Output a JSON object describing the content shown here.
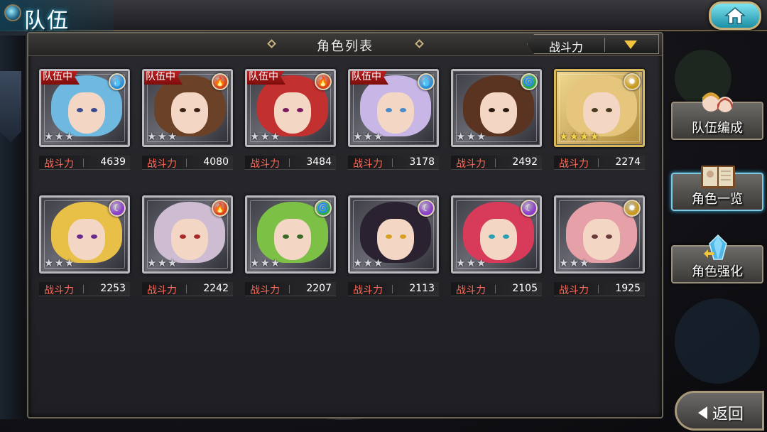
{
  "header": {
    "screen_title": "队伍",
    "home_icon": "home-icon"
  },
  "panel": {
    "title": "角色列表",
    "sort": {
      "label": "战斗力",
      "arrow_icon": "dropdown-triangle-icon"
    }
  },
  "characters": [
    {
      "badge": "队伍中",
      "element": "water",
      "element_color": "#2f8fd6",
      "stars": 3,
      "gold": false,
      "power_label": "战斗力",
      "power": "4639",
      "hair": "#6fb8e0",
      "eyes": "#3b4b8c"
    },
    {
      "badge": "队伍中",
      "element": "fire",
      "element_color": "#d8441c",
      "stars": 3,
      "gold": false,
      "power_label": "战斗力",
      "power": "4080",
      "hair": "#6b4228",
      "eyes": "#3a2214"
    },
    {
      "badge": "队伍中",
      "element": "fire",
      "element_color": "#d8441c",
      "stars": 3,
      "gold": false,
      "power_label": "战斗力",
      "power": "3484",
      "hair": "#c23030",
      "eyes": "#7a1c5c"
    },
    {
      "badge": "队伍中",
      "element": "water",
      "element_color": "#2f8fd6",
      "stars": 3,
      "gold": false,
      "power_label": "战斗力",
      "power": "3178",
      "hair": "#c7b6e6",
      "eyes": "#4a8ac8"
    },
    {
      "badge": "",
      "element": "wind",
      "element_color": "#2fa848",
      "stars": 3,
      "gold": false,
      "power_label": "战斗力",
      "power": "2492",
      "hair": "#5a3420",
      "eyes": "#2a1a10"
    },
    {
      "badge": "",
      "element": "light",
      "element_color": "#c89a20",
      "stars": 4,
      "gold": true,
      "power_label": "战斗力",
      "power": "2274",
      "hair": "#e6c67c",
      "eyes": "#4a3a20"
    },
    {
      "badge": "",
      "element": "dark",
      "element_color": "#8a3ec8",
      "stars": 3,
      "gold": false,
      "power_label": "战斗力",
      "power": "2253",
      "hair": "#e8c048",
      "eyes": "#6a2c8c"
    },
    {
      "badge": "",
      "element": "fire",
      "element_color": "#d8441c",
      "stars": 3,
      "gold": false,
      "power_label": "战斗力",
      "power": "2242",
      "hair": "#cdbcd2",
      "eyes": "#a82828"
    },
    {
      "badge": "",
      "element": "wind",
      "element_color": "#2fa848",
      "stars": 3,
      "gold": false,
      "power_label": "战斗力",
      "power": "2207",
      "hair": "#7cc046",
      "eyes": "#3a6a2a"
    },
    {
      "badge": "",
      "element": "dark",
      "element_color": "#8a3ec8",
      "stars": 3,
      "gold": false,
      "power_label": "战斗力",
      "power": "2113",
      "hair": "#2a2230",
      "eyes": "#d8a020"
    },
    {
      "badge": "",
      "element": "dark",
      "element_color": "#8a3ec8",
      "stars": 3,
      "gold": false,
      "power_label": "战斗力",
      "power": "2105",
      "hair": "#d83a5a",
      "eyes": "#2aa0b0"
    },
    {
      "badge": "",
      "element": "light",
      "element_color": "#c89a20",
      "stars": 3,
      "gold": false,
      "power_label": "战斗力",
      "power": "1925",
      "hair": "#e6a0a8",
      "eyes": "#6a3a3a"
    }
  ],
  "side_menu": [
    {
      "label": "队伍编成",
      "icon": "team-members-icon",
      "active": false
    },
    {
      "label": "角色一览",
      "icon": "character-book-icon",
      "active": true
    },
    {
      "label": "角色强化",
      "icon": "enhance-crystal-icon",
      "active": false
    }
  ],
  "back_button": {
    "label": "返回",
    "icon": "back-arrow-icon"
  }
}
